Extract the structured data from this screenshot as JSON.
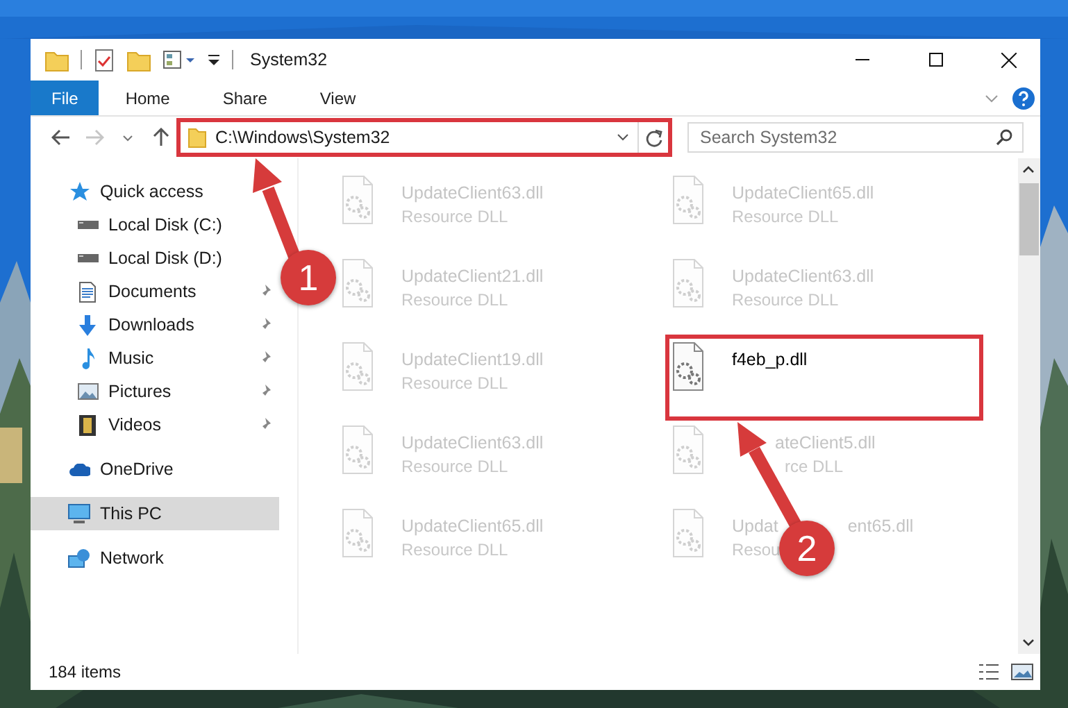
{
  "window": {
    "title": "System32"
  },
  "ribbon": {
    "tabs": [
      {
        "label": "File",
        "kind": "file",
        "selected": false
      },
      {
        "label": "Home",
        "kind": "tab",
        "selected": false
      },
      {
        "label": "Share",
        "kind": "tab",
        "selected": false
      },
      {
        "label": "View",
        "kind": "tab",
        "selected": false
      }
    ]
  },
  "address_bar": {
    "path": "C:\\Windows\\System32"
  },
  "search": {
    "placeholder": "Search System32"
  },
  "navigation": [
    {
      "label": "Quick access",
      "kind": "star",
      "selected": false,
      "children": [
        {
          "label": "Local Disk (C:)",
          "kind": "drive",
          "pinned": false,
          "selected": false
        },
        {
          "label": "Local Disk (D:)",
          "kind": "drive",
          "pinned": false,
          "selected": false
        },
        {
          "label": "Documents",
          "kind": "documents",
          "pinned": true,
          "selected": false
        },
        {
          "label": "Downloads",
          "kind": "downloads",
          "pinned": true,
          "selected": false
        },
        {
          "label": "Music",
          "kind": "music",
          "pinned": true,
          "selected": false
        },
        {
          "label": "Pictures",
          "kind": "pictures",
          "pinned": true,
          "selected": false
        },
        {
          "label": "Videos",
          "kind": "videos",
          "pinned": true,
          "selected": false
        }
      ]
    },
    {
      "label": "OneDrive",
      "kind": "cloud",
      "selected": false
    },
    {
      "label": "This PC",
      "kind": "pc",
      "selected": true
    },
    {
      "label": "Network",
      "kind": "network",
      "selected": false
    }
  ],
  "files": [
    {
      "name": "UpdateClient63.dll",
      "type": "Resource DLL",
      "blurred": true,
      "selected": false
    },
    {
      "name": "UpdateClient65.dll",
      "type": "Resource DLL",
      "blurred": true,
      "selected": false
    },
    {
      "name": "UpdateClient21.dll",
      "type": "Resource DLL",
      "blurred": true,
      "selected": false
    },
    {
      "name": "UpdateClient63.dll",
      "type": "Resource DLL",
      "blurred": true,
      "selected": false
    },
    {
      "name": "UpdateClient19.dll",
      "type": "Resource DLL",
      "blurred": true,
      "selected": false
    },
    {
      "name": "f4eb_p.dll",
      "blurred": false,
      "selected": false
    },
    {
      "name": "UpdateClient63.dll",
      "type": "Resource DLL",
      "blurred": true,
      "selected": false
    },
    {
      "name": "ateClient5.dll",
      "type": "rce DLL",
      "blurred": true,
      "selected": false
    },
    {
      "name": "UpdateClient65.dll",
      "type": "Resource DLL",
      "blurred": true,
      "selected": false
    },
    {
      "name": [
        "Updat",
        "ent65.dll"
      ],
      "type": "Resou",
      "blurred": true,
      "selected": false
    }
  ],
  "status_bar": {
    "item_count": "184 items"
  },
  "callouts": [
    {
      "number": "1"
    },
    {
      "number": "2"
    }
  ]
}
